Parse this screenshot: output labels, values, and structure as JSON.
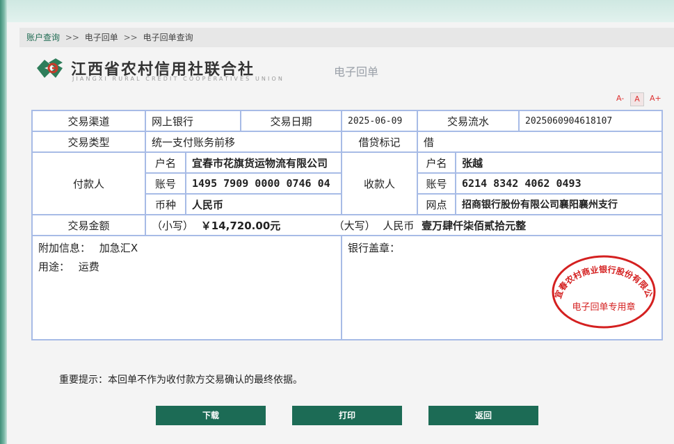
{
  "breadcrumb": [
    "账户查询",
    "电子回单",
    "电子回单查询"
  ],
  "breadcrumb_sep": ">>",
  "logo": {
    "cn": "江西省农村信用社联合社",
    "en": "JIANGXI RURAL CREDIT COOPERATIVES UNION"
  },
  "doc_title": "电子回单",
  "font_controls": {
    "smaller": "A-",
    "normal": "A",
    "larger": "A+"
  },
  "receipt": {
    "channel_label": "交易渠道",
    "channel": "网上银行",
    "date_label": "交易日期",
    "date": "2025-06-09",
    "serial_label": "交易流水",
    "serial": "2025060904618107",
    "type_label": "交易类型",
    "type": "统一支付账务前移",
    "dc_label": "借贷标记",
    "dc": "借",
    "payer_label": "付款人",
    "payee_label": "收款人",
    "name_label": "户名",
    "account_label": "账号",
    "currency_label": "币种",
    "branch_label": "网点",
    "payer_name": "宜春市花旗货运物流有限公司",
    "payer_account": "1495 7909 0000 0746 04",
    "payer_currency": "人民币",
    "payee_name": "张越",
    "payee_account": "6214 8342 4062 0493",
    "payee_branch": "招商银行股份有限公司襄阳襄州支行",
    "amount_label": "交易金额",
    "amount_small_label": "（小写）",
    "amount_small": "￥14,720.00元",
    "amount_big_label": "（大写）",
    "amount_big_currency": "人民币",
    "amount_big": "壹万肆仟柒佰贰拾元整",
    "extra_label": "附加信息：",
    "extra_value": "加急汇",
    "extra_close": "X",
    "purpose_label": "用途：",
    "purpose_value": "运费",
    "bank_seal_label": "银行盖章："
  },
  "stamp": {
    "arc_text": "宜春农村商业银行股份有限公司",
    "center_text": "电子回单专用章",
    "color": "#d42020"
  },
  "notice": "重要提示：本回单不作为收付款方交易确认的最终依据。",
  "buttons": {
    "download": "下载",
    "print": "打印",
    "back": "返回"
  },
  "colors": {
    "accent": "#1c6b55",
    "table_border": "#a7bbe6"
  }
}
